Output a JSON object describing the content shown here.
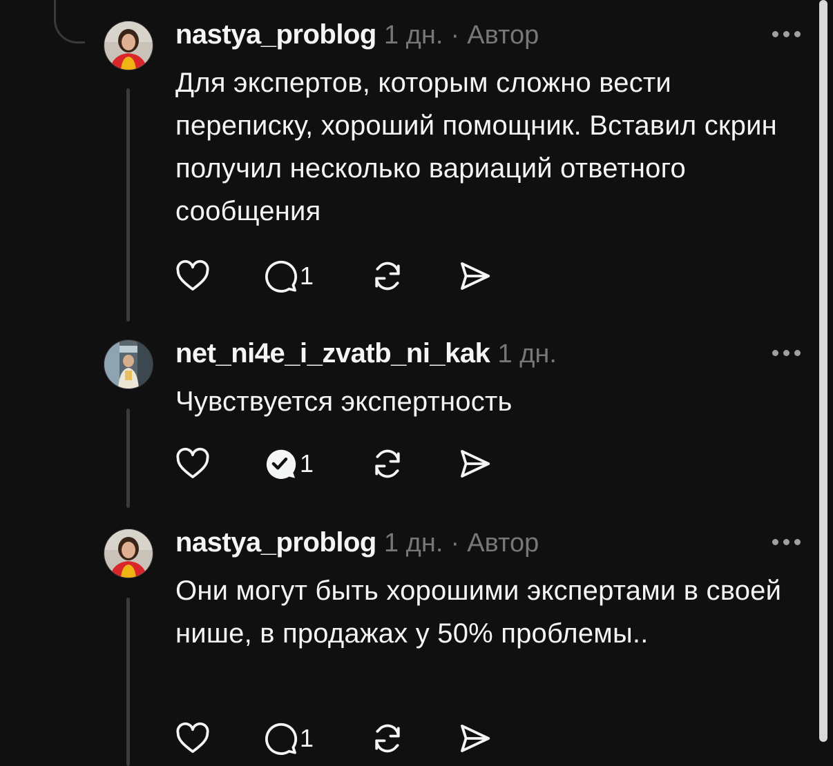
{
  "comments": [
    {
      "username": "nastya_problog",
      "time": "1 дн.",
      "separator": "·",
      "badge": "Автор",
      "text": "Для экспертов, которым сложно вести переписку, хороший помощник. Вставил скрин получил несколько вариаций ответного сообщения",
      "reply_count": "1",
      "replied": false
    },
    {
      "username": "net_ni4e_i_zvatb_ni_kak",
      "time": "1 дн.",
      "separator": "",
      "badge": "",
      "text": "Чувствуется экспертность",
      "reply_count": "1",
      "replied": true
    },
    {
      "username": "nastya_problog",
      "time": "1 дн.",
      "separator": "·",
      "badge": "Автор",
      "text": "Они могут быть хорошими экспертами в своей нише, в продажах у 50% проблемы..",
      "reply_count": "1",
      "replied": false
    }
  ],
  "icons": {
    "like": "heart-icon",
    "reply": "speech-bubble-icon",
    "replied": "speech-bubble-check-icon",
    "repost": "repost-icon",
    "share": "send-icon",
    "more": "more-icon"
  },
  "colors": {
    "background": "#101010",
    "primary_text": "#f3f5f7",
    "secondary_text": "#777777",
    "thread_line": "#3b3b3b"
  }
}
